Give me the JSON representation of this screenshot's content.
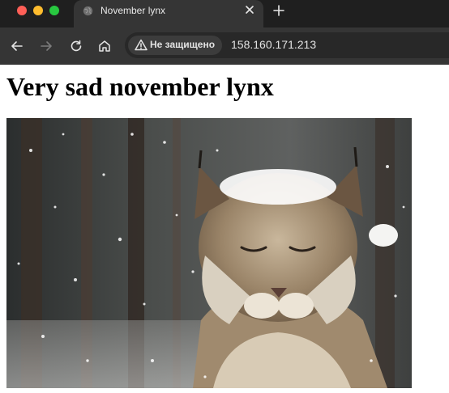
{
  "window": {
    "controls": [
      "close",
      "minimize",
      "maximize"
    ]
  },
  "tab": {
    "title": "November lynx",
    "favicon": "globe-icon",
    "close_icon": "close-icon"
  },
  "new_tab_icon": "plus-icon",
  "toolbar": {
    "back_icon": "arrow-left-icon",
    "forward_icon": "arrow-right-icon",
    "reload_icon": "reload-icon",
    "home_icon": "home-icon"
  },
  "address_bar": {
    "security_icon": "warning-triangle-icon",
    "security_label": "Не защищено",
    "url": "158.160.171.213"
  },
  "page": {
    "heading": "Very sad november lynx",
    "image": "photo of a lynx with eyes closed and snow on its head, in a snowy forest"
  },
  "colors": {
    "chrome_dark": "#1f1f1f",
    "toolbar": "#353535",
    "omnibox": "#282828",
    "close_red": "#ff5f57",
    "minimize_yellow": "#febc2e",
    "maximize_green": "#28c840"
  }
}
